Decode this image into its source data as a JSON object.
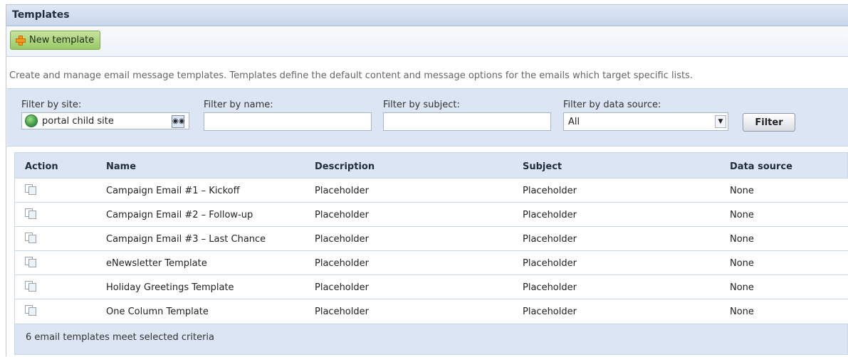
{
  "panel": {
    "title": "Templates",
    "toolbar": {
      "new_button": "New template"
    },
    "description": "Create and manage email message templates. Templates define the default content and message options for the emails which target specific lists."
  },
  "filters": {
    "site": {
      "label": "Filter by site:",
      "value": "portal child site"
    },
    "name": {
      "label": "Filter by name:",
      "value": ""
    },
    "subject": {
      "label": "Filter by subject:",
      "value": ""
    },
    "data_source": {
      "label": "Filter by data source:",
      "value": "All"
    },
    "button": "Filter"
  },
  "table": {
    "headers": [
      "Action",
      "Name",
      "Description",
      "Subject",
      "Data source"
    ],
    "rows": [
      {
        "name": "Campaign Email #1 – Kickoff",
        "description": "Placeholder",
        "subject": "Placeholder",
        "data_source": "None"
      },
      {
        "name": "Campaign Email #2 – Follow-up",
        "description": "Placeholder",
        "subject": "Placeholder",
        "data_source": "None"
      },
      {
        "name": "Campaign Email #3 – Last Chance",
        "description": "Placeholder",
        "subject": "Placeholder",
        "data_source": "None"
      },
      {
        "name": "eNewsletter Template",
        "description": "Placeholder",
        "subject": "Placeholder",
        "data_source": "None"
      },
      {
        "name": "Holiday Greetings Template",
        "description": "Placeholder",
        "subject": "Placeholder",
        "data_source": "None"
      },
      {
        "name": "One Column Template",
        "description": "Placeholder",
        "subject": "Placeholder",
        "data_source": "None"
      }
    ],
    "footer": "6 email templates meet selected criteria"
  },
  "icons": {
    "new_button_icon": "plus-icon",
    "site_icon": "globe-icon",
    "site_lookup_icon": "binoculars-icon",
    "row_action_icon": "copy-icon",
    "select_arrow_icon": "chevron-down-icon"
  }
}
